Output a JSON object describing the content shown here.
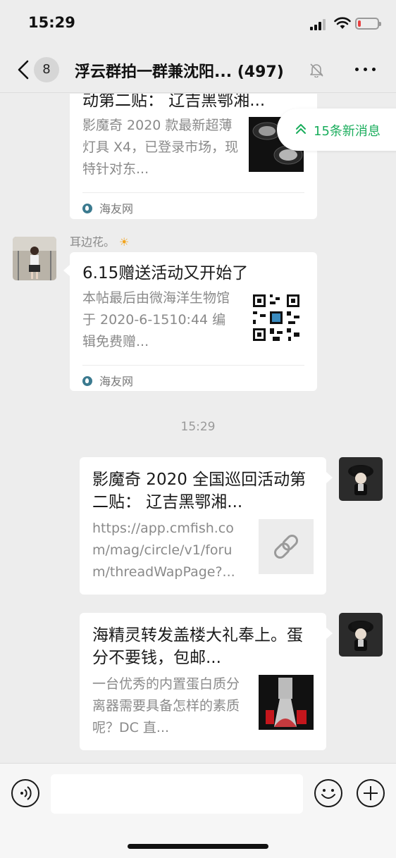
{
  "status_bar": {
    "time": "15:29",
    "battery_level": 0.15,
    "battery_color": "#e84040"
  },
  "nav": {
    "back_badge": "8",
    "title": "浮云群拍一群兼沈阳... (497)",
    "icons": [
      "chevron-left-icon",
      "mute-bell-icon",
      "more-icon"
    ]
  },
  "new_messages": {
    "label": "15条新消息",
    "color": "#1aad5c"
  },
  "messages": [
    {
      "sender": "",
      "title": "动第二贴： 辽吉黑鄂湘...",
      "desc": "影魔奇 2020 款最新超薄灯具 X4，已登录市场，现特针对东...",
      "source": "海友网",
      "thumb": "lamp-photo"
    },
    {
      "sender": "耳边花。",
      "sender_emoji": "☀",
      "title": "6.15赠送活动又开始了",
      "desc": "本帖最后由微海洋生物馆于 2020-6-1510:44 编辑免费赠...",
      "source": "海友网",
      "thumb": "qr-code"
    },
    {
      "timestamp": "15:29"
    },
    {
      "sender": "me",
      "title": "影魔奇 2020 全国巡回活动第二贴： 辽吉黑鄂湘...",
      "desc": "https://app.cmfish.com/mag/circle/v1/forum/threadWapPage?...",
      "thumb": "link-icon"
    },
    {
      "sender": "me",
      "title": "海精灵转发盖楼大礼奉上。蛋分不要钱，包邮...",
      "desc": "一台优秀的内置蛋白质分离器需要具备怎样的素质呢？DC 直...",
      "thumb": "skimmer-photo"
    }
  ],
  "input_bar": {
    "placeholder": "",
    "icons": [
      "voice-icon",
      "emoji-icon",
      "plus-icon"
    ]
  }
}
